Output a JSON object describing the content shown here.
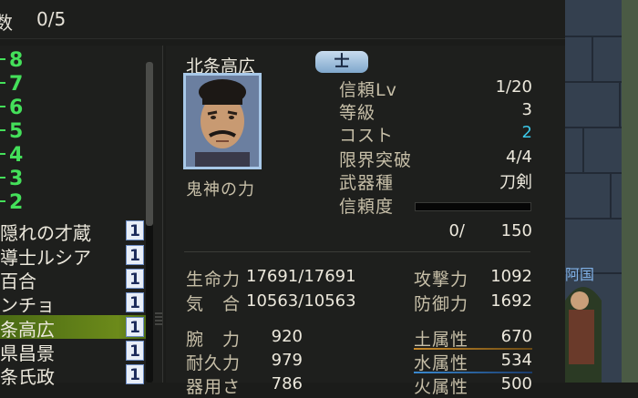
{
  "topbar": {
    "left_char": "数",
    "count": "0/5"
  },
  "level_list": [
    {
      "label": "8"
    },
    {
      "label": "7"
    },
    {
      "label": "6"
    },
    {
      "label": "5"
    },
    {
      "label": "4"
    },
    {
      "label": "3"
    },
    {
      "label": "2"
    }
  ],
  "name_list": [
    {
      "name": "隠れの才蔵",
      "badge": "1"
    },
    {
      "name": "導士ルシア",
      "badge": "1"
    },
    {
      "name": "百合",
      "badge": "1"
    },
    {
      "name": "ンチョ",
      "badge": "1"
    },
    {
      "name": "条高広",
      "badge": "1"
    },
    {
      "name": "県昌景",
      "badge": "1"
    },
    {
      "name": "条氏政",
      "badge": "1"
    }
  ],
  "character": {
    "name": "北条高広",
    "rank": "士",
    "skill": "鬼神の力"
  },
  "info": {
    "trust_lv_label": "信頼Lv",
    "trust_lv": "1/20",
    "grade_label": "等級",
    "grade": "3",
    "cost_label": "コスト",
    "cost": "2",
    "limit_label": "限界突破",
    "limit": "4/4",
    "weapon_label": "武器種",
    "weapon": "刀剣",
    "trust_label": "信頼度",
    "trust_current": "0/",
    "trust_max": "150",
    "trust_fill": 0.0
  },
  "stats": {
    "hp_label": "生命力",
    "hp": "17691/17691",
    "ki_label": "気　合",
    "ki": "10563/10563",
    "atk_label": "攻撃力",
    "atk": "1092",
    "def_label": "防御力",
    "def": "1692",
    "arm_label": "腕　力",
    "arm": "920",
    "dur_label": "耐久力",
    "dur": "979",
    "third_label": "器用さ",
    "third": "786",
    "earth_label": "土属性",
    "earth": "670",
    "water_label": "水属性",
    "water": "534",
    "fire_label": "火属性",
    "fire": "500"
  },
  "right_edge_text": "阿国",
  "colors": {
    "level": "#44e05a",
    "cost": "#3cc8e8",
    "selected_row": "#6c8a1a",
    "badge_bg": "#e8eef8"
  }
}
